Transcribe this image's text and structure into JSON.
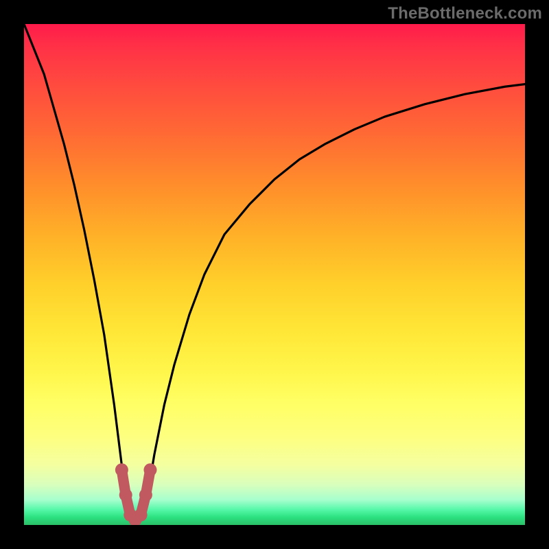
{
  "watermark": "TheBottleneck.com",
  "colors": {
    "frame": "#000000",
    "curve_stroke": "#000000",
    "marker_fill": "#c05a60",
    "marker_stroke": "#a84c52"
  },
  "chart_data": {
    "type": "line",
    "title": "",
    "xlabel": "",
    "ylabel": "",
    "xlim": [
      0,
      100
    ],
    "ylim": [
      0,
      100
    ],
    "grid": false,
    "note": "Axes are unlabeled. Values estimated from gridless plot; x is normalized horizontal position, y is normalized height (0=bottom, 100=top). Curve reaches a minimum ~0 near x≈22 (bottleneck) and rises steeply on both sides.",
    "series": [
      {
        "name": "bottleneck-curve",
        "x": [
          0,
          2,
          4,
          6,
          8,
          10,
          12,
          14,
          16,
          18,
          19,
          20,
          21,
          22,
          23,
          24,
          25,
          26,
          28,
          30,
          33,
          36,
          40,
          45,
          50,
          55,
          60,
          66,
          72,
          80,
          88,
          96,
          100
        ],
        "y": [
          100,
          95,
          90,
          83,
          76,
          68,
          59,
          49,
          38,
          24,
          16,
          8,
          3,
          1,
          1,
          3,
          8,
          14,
          24,
          32,
          42,
          50,
          58,
          64,
          69,
          73,
          76,
          79,
          81.5,
          84,
          86,
          87.5,
          88
        ]
      }
    ],
    "markers": [
      {
        "name": "marker-left-top",
        "x": 19.5,
        "y": 11
      },
      {
        "name": "marker-left-mid",
        "x": 20.3,
        "y": 6
      },
      {
        "name": "marker-bottom-l",
        "x": 21.2,
        "y": 2
      },
      {
        "name": "marker-bottom-c",
        "x": 22.2,
        "y": 1
      },
      {
        "name": "marker-bottom-r",
        "x": 23.3,
        "y": 2
      },
      {
        "name": "marker-right-mid",
        "x": 24.3,
        "y": 6
      },
      {
        "name": "marker-right-top",
        "x": 25.2,
        "y": 11
      }
    ]
  }
}
